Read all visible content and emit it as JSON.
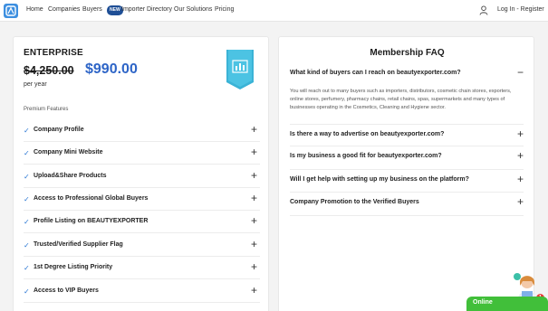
{
  "nav": {
    "items": [
      "Home",
      "Companies",
      "Buyers",
      "Importer Directory",
      "Our Solutions",
      "Pricing"
    ],
    "new_badge": "NEW",
    "auth": "Log In - Register"
  },
  "plan": {
    "name": "ENTERPRISE",
    "old_price": "$4,250.00",
    "new_price": "$990.00",
    "period": "per year",
    "section_title": "Premium Features",
    "features": [
      "Company Profile",
      "Company Mini Website",
      "Upload&Share Products",
      "Access to Professional Global Buyers",
      "Profile Listing on BEAUTYEXPORTER",
      "Trusted/Verified Supplier Flag",
      "1st Degree Listing Priority",
      "Access to VIP Buyers"
    ],
    "check_glyph": "✓",
    "plus_glyph": "+"
  },
  "faq": {
    "title": "Membership FAQ",
    "items": [
      {
        "q": "What kind of buyers can I reach on beautyexporter.com?",
        "toggle": "−"
      },
      {
        "q": "Is there a way to advertise on beautyexporter.com?",
        "toggle": "+"
      },
      {
        "q": "Is my business a good fit for beautyexporter.com?",
        "toggle": "+"
      },
      {
        "q": "Will I get help with setting up my business on the platform?",
        "toggle": "+"
      },
      {
        "q": "Company Promotion to the Verified Buyers",
        "toggle": "+"
      }
    ],
    "answer": "You will reach out to many buyers such as importers, distributors, cosmetic chain stores, exporters, online stores, perfumery, pharmacy chains, retail chains, spas, supermarkets and many types of businesses operating in the Cosmetics, Cleaning and Hygiene sector."
  },
  "chat": {
    "status": "Online",
    "badge_count": "1"
  },
  "colors": {
    "accent": "#2e65c7",
    "chat_green": "#41bf3a",
    "ribbon": "#3bb3d6"
  },
  "icons": [
    "logo-icon",
    "user-icon",
    "ribbon-chart-icon",
    "check-icon",
    "plus-icon",
    "minus-icon",
    "chat-avatar"
  ]
}
